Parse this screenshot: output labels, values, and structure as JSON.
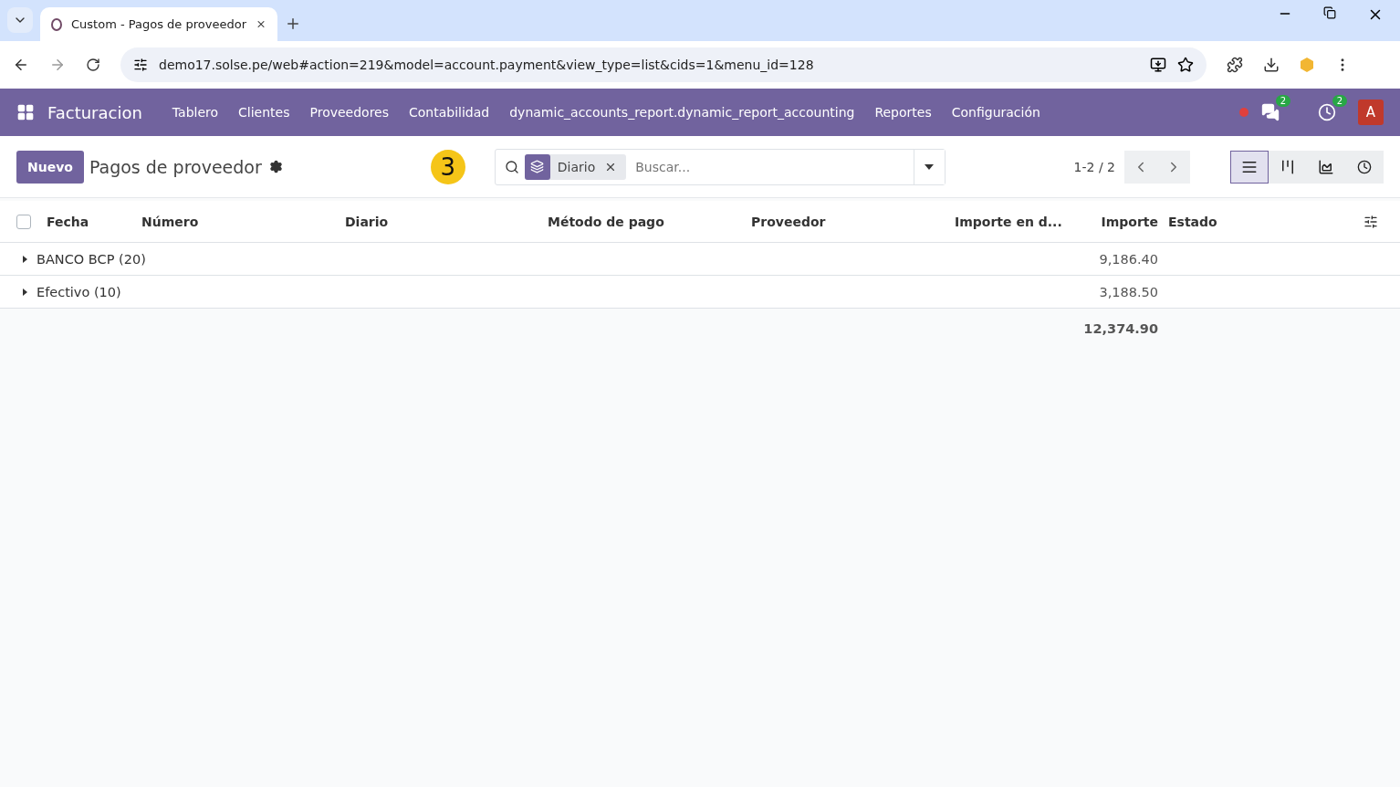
{
  "browser": {
    "tabs": [
      {
        "title": "Custom - Pagos de proveedor",
        "selected": true
      }
    ],
    "url": "demo17.solse.pe/web#action=219&model=account.payment&view_type=list&cids=1&menu_id=128"
  },
  "navbar": {
    "app_name": "Facturacion",
    "menu": [
      "Tablero",
      "Clientes",
      "Proveedores",
      "Contabilidad",
      "dynamic_accounts_report.dynamic_report_accounting",
      "Reportes",
      "Configuración"
    ],
    "messages_count": "2",
    "activities_count": "2",
    "avatar": "A"
  },
  "control_panel": {
    "new_button": "Nuevo",
    "title": "Pagos de proveedor",
    "step_badge": "3",
    "search": {
      "facets": [
        {
          "label": "Diario"
        }
      ],
      "placeholder": "Buscar..."
    },
    "pager": "1-2 / 2",
    "views": [
      {
        "kind": "list",
        "selected": true
      },
      {
        "kind": "kanban",
        "selected": false
      },
      {
        "kind": "graph",
        "selected": false
      },
      {
        "kind": "activity",
        "selected": false
      }
    ]
  },
  "table": {
    "select_all_checked": false,
    "columns": [
      {
        "label": "Fecha"
      },
      {
        "label": "Número"
      },
      {
        "label": "Diario"
      },
      {
        "label": "Método de pago"
      },
      {
        "label": "Proveedor"
      },
      {
        "label": "Importe en d..."
      },
      {
        "label": "Importe"
      },
      {
        "label": "Estado"
      }
    ],
    "groups": [
      {
        "label": "BANCO BCP (20)",
        "amount": "9,186.40",
        "expanded": false
      },
      {
        "label": "Efectivo (10)",
        "amount": "3,188.50",
        "expanded": false
      }
    ],
    "total": "12,374.90"
  }
}
